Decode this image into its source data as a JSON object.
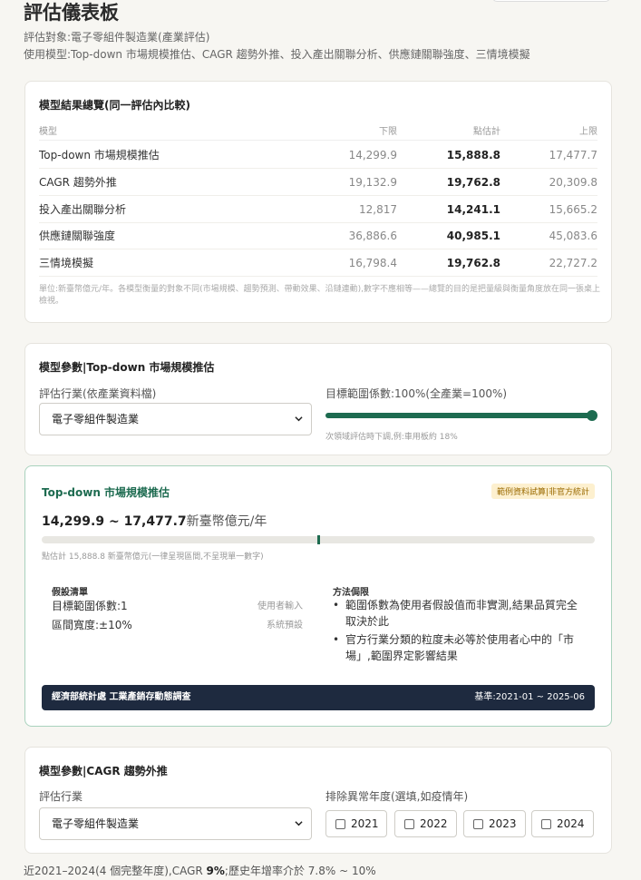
{
  "header": {
    "title": "評估儀表板",
    "subject_line": "評估對象:電子零組件製造業(產業評估)",
    "models_line": "使用模型:Top-down 市場規模推估、CAGR 趨勢外推、投入產出關聯分析、供應鏈關聯強度、三情境模擬"
  },
  "summary": {
    "title": "模型結果總覽(同一評估內比較)",
    "columns": {
      "model": "模型",
      "low": "下限",
      "point": "點估計",
      "high": "上限"
    },
    "rows": [
      {
        "model": "Top-down 市場規模推估",
        "low": "14,299.9",
        "point": "15,888.8",
        "high": "17,477.7"
      },
      {
        "model": "CAGR 趨勢外推",
        "low": "19,132.9",
        "point": "19,762.8",
        "high": "20,309.8"
      },
      {
        "model": "投入產出關聯分析",
        "low": "12,817",
        "point": "14,241.1",
        "high": "15,665.2"
      },
      {
        "model": "供應鏈關聯強度",
        "low": "36,886.6",
        "point": "40,985.1",
        "high": "45,083.6"
      },
      {
        "model": "三情境模擬",
        "low": "16,798.4",
        "point": "19,762.8",
        "high": "22,727.2"
      }
    ],
    "note": "單位:新臺幣億元/年。各模型衡量的對象不同(市場規模、趨勢預測、帶動效果、沿鏈連動),數字不應相等——總覽的目的是把量級與衡量角度放在同一張桌上檢視。"
  },
  "params_topdown": {
    "title": "模型參數|Top-down 市場規模推估",
    "industry_label": "評估行業(依產業資料檔)",
    "industry_value": "電子零組件製造業",
    "scope_label": "目標範圍係數:100%(全產業=100%)",
    "scope_value": 1.0,
    "scope_hint": "次領域評估時下調,例:車用板約 18%"
  },
  "result": {
    "title": "Top-down 市場規模推估",
    "badge": "範例資料試算|非官方統計",
    "range_text": "14,299.9 ~ 17,477.7",
    "range_unit": "新臺幣億元/年",
    "point_fraction": 0.5,
    "caption": "點估計 15,888.8 新臺幣億元(一律呈現區間,不呈現單一數字)",
    "assumptions_title": "假設清單",
    "assumptions": [
      {
        "label": "目標範圍係數:1",
        "source": "使用者輸入"
      },
      {
        "label": "區間寬度:±10%",
        "source": "系統預設"
      }
    ],
    "limits_title": "方法侷限",
    "limits": [
      "範圍係數為使用者假設值而非實測,結果品質完全取決於此",
      "官方行業分類的粒度未必等於使用者心中的「市場」,範圍界定影響結果"
    ],
    "source_name": "經濟部統計處 工業產銷存動態調查",
    "source_period": "基準:2021-01 ~ 2025-06"
  },
  "params_cagr": {
    "title": "模型參數|CAGR 趨勢外推",
    "industry_label": "評估行業",
    "industry_value": "電子零組件製造業",
    "exclude_label": "排除異常年度(選填,如疫情年)",
    "years": [
      "2021",
      "2022",
      "2023",
      "2024"
    ]
  },
  "footer_line": {
    "prefix": "近2021–2024(4 個完整年度),CAGR ",
    "cagr": "9%",
    "suffix": ";歷史年增率介於 7.8% ~ 10%"
  },
  "colors": {
    "accent": "#1d6b50",
    "badge_bg": "#fdf0cf",
    "source_bar": "#1e2a3f"
  }
}
